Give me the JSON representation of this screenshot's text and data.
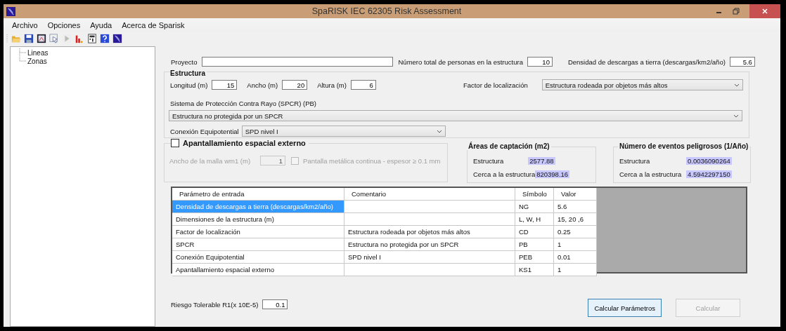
{
  "window": {
    "title": "SpaRISK IEC 62305 Risk Assessment"
  },
  "menu": [
    "Archivo",
    "Opciones",
    "Ayuda",
    "Acerca de Sparisk"
  ],
  "tree": [
    {
      "label": "Lineas"
    },
    {
      "label": "Zonas"
    }
  ],
  "project": {
    "label": "Proyecto"
  },
  "persons": {
    "label": "Número total de personas en la estructura",
    "value": "10"
  },
  "density": {
    "label": "Densidad de descargas a tierra (descargas/km2/año)",
    "value": "5.6"
  },
  "estructura": {
    "title": "Estructura",
    "dims": [
      {
        "label": "Longitud (m)",
        "value": "15"
      },
      {
        "label": "Ancho (m)",
        "value": "20"
      },
      {
        "label": "Altura (m)",
        "value": "6"
      }
    ],
    "factor": {
      "label": "Factor de localización",
      "value": "Estructura rodeada por objetos más altos"
    },
    "spcr": {
      "label": "Sistema de Protección Contra Rayo (SPCR) (PB)",
      "value": "Estructura no protegida por un SPCR"
    },
    "conexion": {
      "label": "Conexión Equipotential",
      "value": "SPD nivel I"
    }
  },
  "shield": {
    "title": "Apantallamiento espacial externo",
    "checked": false,
    "mesh": {
      "label": "Ancho de la malla wm1 (m)",
      "value": "1",
      "disabled": true
    },
    "screen": {
      "label": "Pantalla metálica continua - espesor ≥ 0.1 mm",
      "checked": false,
      "disabled": true
    }
  },
  "areas": {
    "title": "Áreas de captación (m2)",
    "rows": [
      {
        "label": "Estructura",
        "value": "2577.88"
      },
      {
        "label": "Cerca a la estructura",
        "value": "820398.16"
      }
    ]
  },
  "events": {
    "title": "Número de eventos peligrosos (1/Año)",
    "rows": [
      {
        "label": "Estructura",
        "value": "0.0036090264"
      },
      {
        "label": "Cerca a la estructura",
        "value": "4.5942297150"
      }
    ]
  },
  "table": {
    "columns": [
      "Parámetro de entrada",
      "Comentario",
      "Símbolo",
      "Valor"
    ],
    "rows": [
      {
        "cells": [
          "Densidad de descargas a tierra (descargas/km2/año)",
          "",
          "NG",
          "5.6"
        ],
        "selected": true
      },
      {
        "cells": [
          "Dimensiones de la estructura (m)",
          "",
          "L, W, H",
          "15, 20 ,6"
        ],
        "selected": false
      },
      {
        "cells": [
          "Factor de localización",
          "Estructura rodeada por objetos más altos",
          "CD",
          "0.25"
        ],
        "selected": false
      },
      {
        "cells": [
          "SPCR",
          "Estructura no protegida por un SPCR",
          "PB",
          "1"
        ],
        "selected": false
      },
      {
        "cells": [
          "Conexión Equipotential",
          "SPD nivel I",
          "PEB",
          "0.01"
        ],
        "selected": false
      },
      {
        "cells": [
          "Apantallamiento espacial externo",
          "",
          "KS1",
          "1"
        ],
        "selected": false
      }
    ]
  },
  "risk": {
    "label": "Riesgo Tolerable R1(x 10E-5)",
    "value": "0.1"
  },
  "buttons": [
    {
      "label": "Calcular Parámetros",
      "disabled": false,
      "focused": true
    },
    {
      "label": "Calcular",
      "disabled": true,
      "focused": false
    }
  ]
}
